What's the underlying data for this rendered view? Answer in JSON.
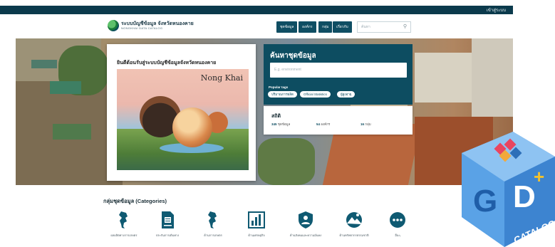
{
  "topbar": {
    "login_label": "เข้าสู่ระบบ"
  },
  "brand": {
    "title": "ระบบบัญชีข้อมูล จังหวัดหนองคาย",
    "subtitle": "NONGKHAI DATA CATALOG"
  },
  "nav": {
    "items": [
      {
        "label": "ชุดข้อมูล"
      },
      {
        "label": "องค์กร"
      },
      {
        "label": "กลุ่ม"
      },
      {
        "label": "เกี่ยวกับ"
      }
    ],
    "search_placeholder": "ค้นหา"
  },
  "welcome": {
    "title": "ยินดีต้อนรับสู่ระบบบัญชีข้อมูลจังหวัดหนองคาย",
    "poster_text": "Nong Khai"
  },
  "search_panel": {
    "title": "ค้นหาชุดข้อมูล",
    "placeholder": "E.g. environment",
    "tags_label": "Popular tags",
    "tags": [
      {
        "label": "ปริมาณการผลิต"
      },
      {
        "label": "Official Statistics"
      },
      {
        "label": "ผู้สูงอายุ"
      }
    ]
  },
  "stats": {
    "title": "สถิติ",
    "items": [
      {
        "value": "345",
        "label": "ชุดข้อมูล"
      },
      {
        "value": "54",
        "label": "องค์กร"
      },
      {
        "value": "16",
        "label": "กลุ่ม"
      }
    ]
  },
  "categories": {
    "heading": "กลุ่มชุดข้อมูล (Categories)",
    "items": [
      {
        "label": "ผลผลิตทางการเกษตร",
        "icon": "thailand-map-icon"
      },
      {
        "label": "ประกันการเดินทาง",
        "icon": "document-icon"
      },
      {
        "label": "ด้านการเกษตร",
        "icon": "thailand-map-icon"
      },
      {
        "label": "ด้านเศรษฐกิจ",
        "icon": "bar-chart-icon"
      },
      {
        "label": "ด้านสังคมและความมั่นคง",
        "icon": "shield-people-icon"
      },
      {
        "label": "ด้านทรัพยากรธรรมชาติ",
        "icon": "mountain-icon"
      },
      {
        "label": "อื่นๆ",
        "icon": "more-icon"
      }
    ]
  },
  "colors": {
    "primary": "#0d4d61",
    "topbar": "#0b3a4c",
    "icon": "#0f5a72"
  }
}
